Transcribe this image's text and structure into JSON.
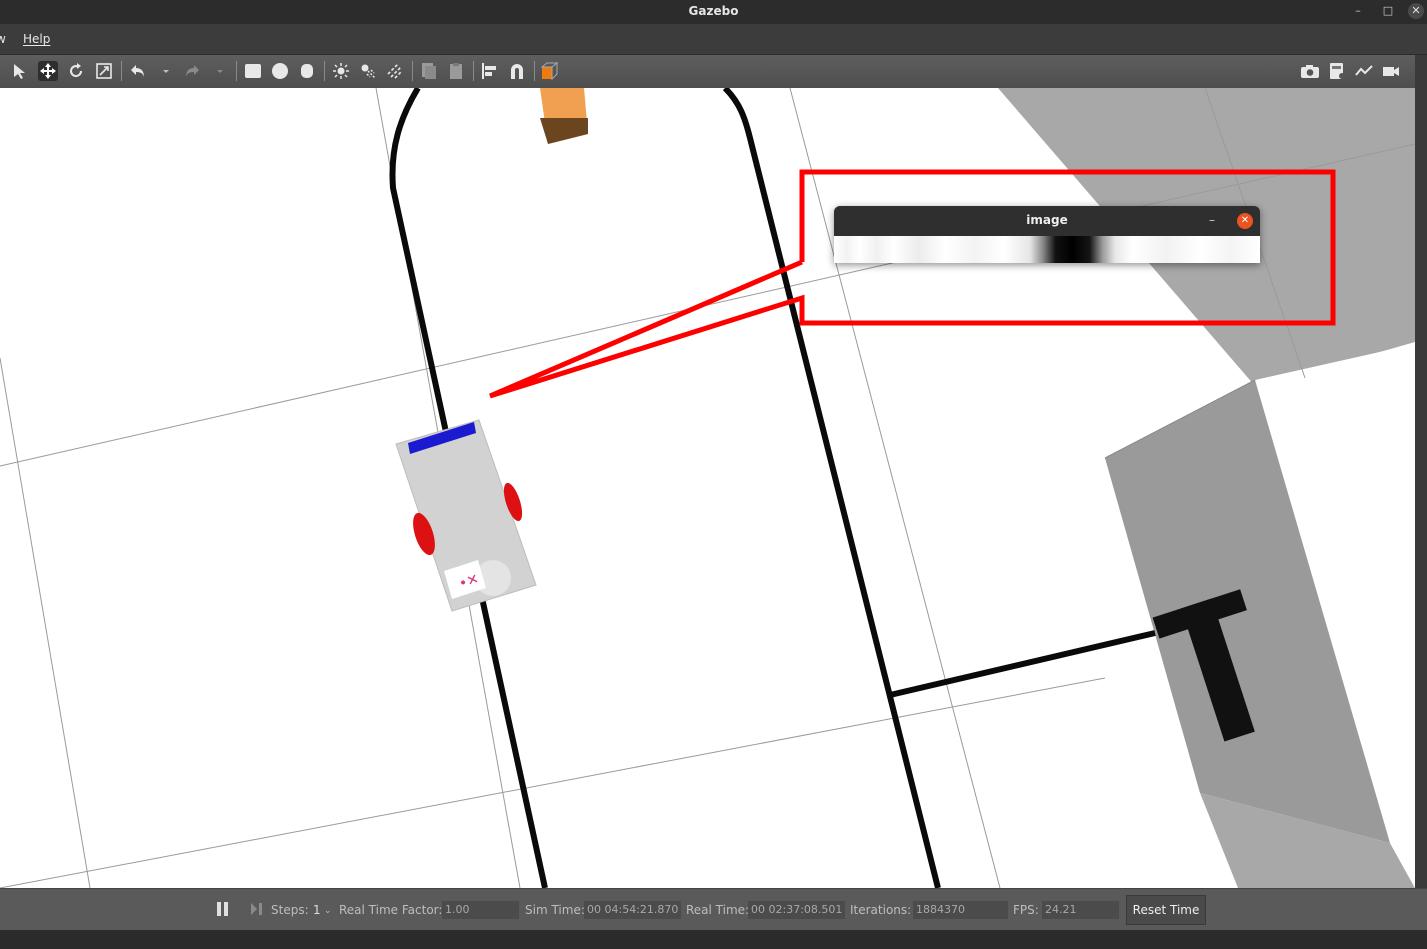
{
  "window": {
    "title": "Gazebo"
  },
  "menu": {
    "items": [
      "w",
      "Help"
    ]
  },
  "toolbar": {
    "tools": [
      "select-arrow-icon",
      "translate-icon",
      "rotate-icon",
      "scale-icon",
      "undo-icon",
      "undo-dropdown-icon",
      "redo-icon",
      "redo-dropdown-icon",
      "box-shape-icon",
      "sphere-shape-icon",
      "cylinder-shape-icon",
      "point-light-icon",
      "spot-light-icon",
      "directional-light-icon",
      "copy-icon",
      "paste-icon",
      "align-icon",
      "snap-magnet-icon",
      "view-angle-icon"
    ],
    "right_tools": [
      "camera-screenshot-icon",
      "log-recording-icon",
      "plot-icon",
      "video-record-icon"
    ]
  },
  "image_window": {
    "title": "image",
    "minimize": "–",
    "close": "✕"
  },
  "status": {
    "steps_label": "Steps:",
    "steps_value": "1",
    "rtf_label": "Real Time Factor:",
    "rtf_value": "1.00",
    "sim_time_label": "Sim Time:",
    "sim_time_value": "00 04:54:21.870",
    "real_time_label": "Real Time:",
    "real_time_value": "00 02:37:08.501",
    "iterations_label": "Iterations:",
    "iterations_value": "1884370",
    "fps_label": "FPS:",
    "fps_value": "24.21",
    "reset_label": "Reset Time"
  },
  "scene": {
    "sign_label": "T"
  },
  "colors": {
    "annotation": "#ff0000",
    "close_button": "#e95420",
    "robot_marker": "#1a1ad0",
    "robot_wheels": "#dd1111"
  }
}
